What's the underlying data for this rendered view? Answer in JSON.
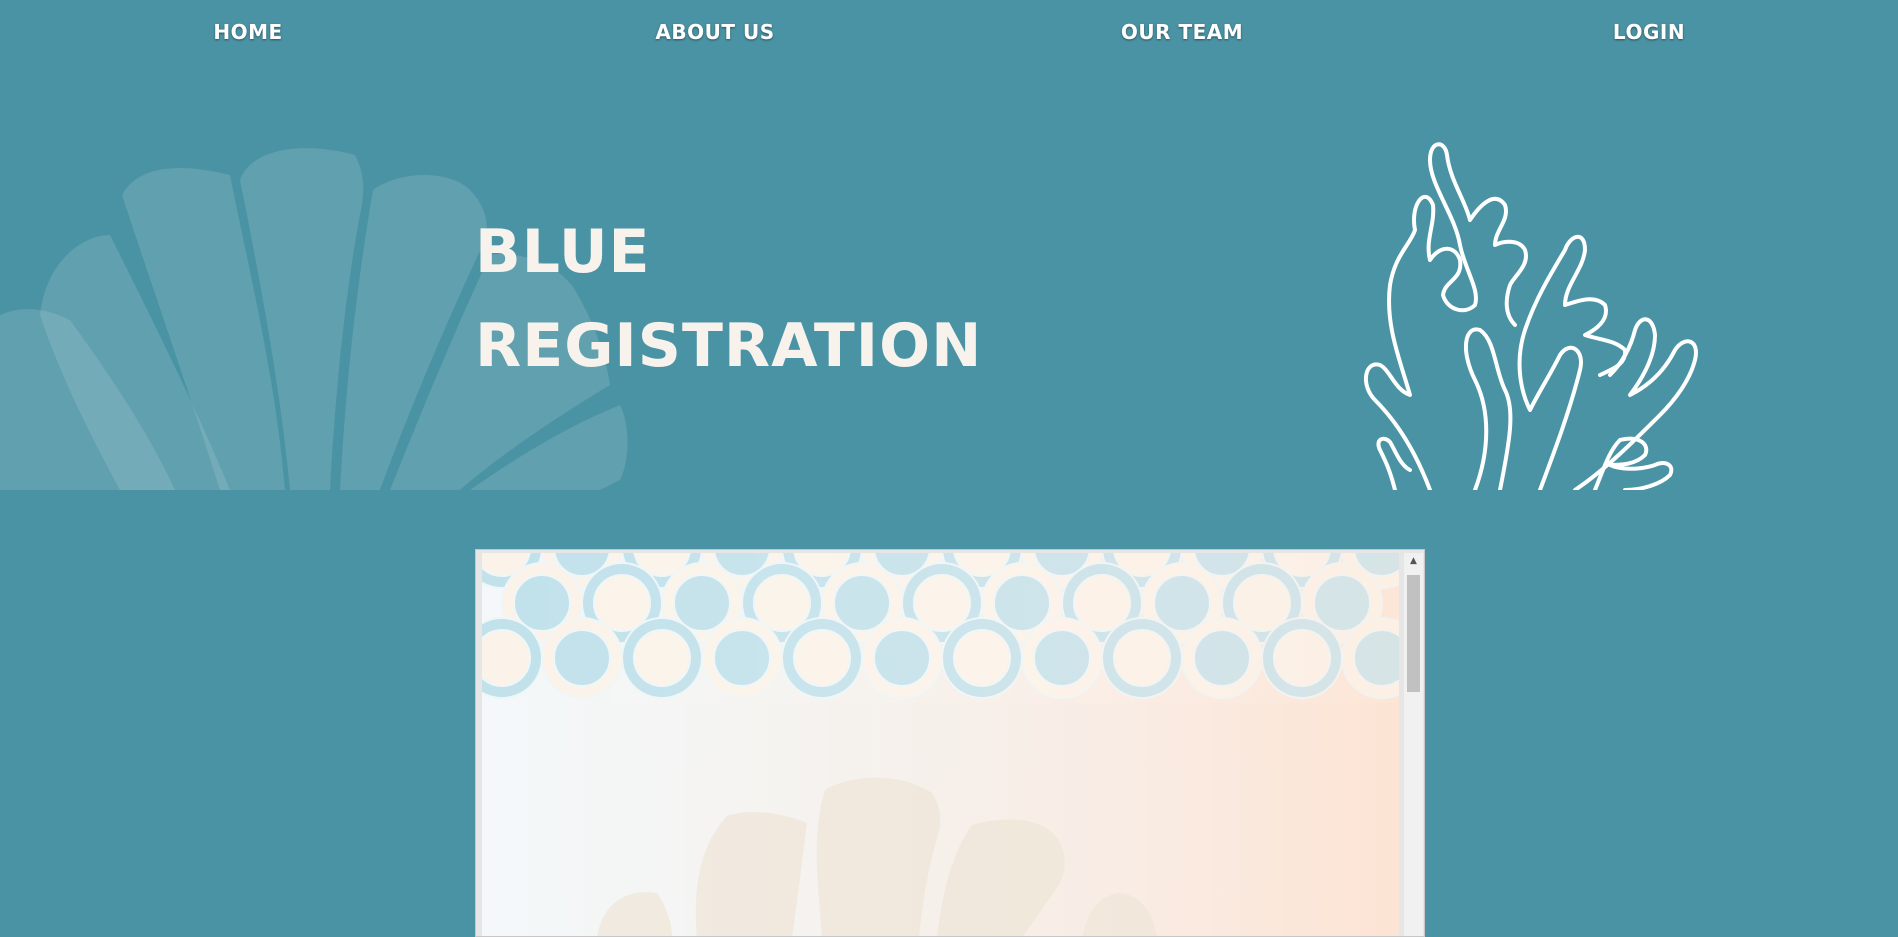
{
  "nav": {
    "home": "HOME",
    "about": "ABOUT US",
    "team": "OUR TEAM",
    "login": "LOGIN"
  },
  "hero": {
    "title_line1": "BLUE",
    "title_line2": "REGISTRATION",
    "shell_icon": "seashell-icon",
    "coral_icon": "coral-icon"
  },
  "embed": {
    "pattern_icon": "scale-pattern",
    "shell_icon": "seashell-icon"
  },
  "colors": {
    "background": "#4a93a4",
    "title": "#f7f2ec",
    "nav_text": "#ffffff",
    "shell_overlay": "#6aa7b5",
    "scale_blue": "#c1e1eb",
    "scale_cream": "#fbf3e9"
  }
}
